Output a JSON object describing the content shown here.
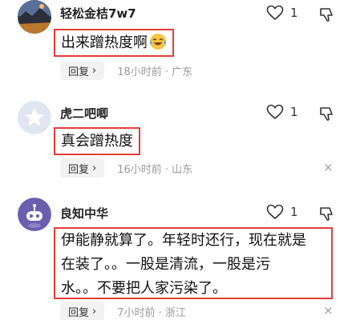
{
  "comments": [
    {
      "username": "轻松金桔7w7",
      "text": "出来蹭热度啊",
      "emoji": "crying-laughing-face-icon",
      "likes": "1",
      "reply_label": "回复",
      "reply_arrow": "›",
      "time_location": "18小时前 · 广东",
      "avatar": "landscape-photo-avatar"
    },
    {
      "username": "虎二吧唧",
      "text": "真会蹭热度",
      "likes": "1",
      "reply_label": "回复",
      "reply_arrow": "›",
      "time_location": "16小时前 · 山东",
      "close_symbol": "×",
      "avatar": "default-star-avatar"
    },
    {
      "username": "良知中华",
      "text_lines": [
        "伊能静就算了。年轻时还行，现在就是",
        "在装了。。一股是清流，一股是污",
        "水。。不要把人家污染了。"
      ],
      "likes": "1",
      "reply_label": "回复",
      "reply_arrow": "›",
      "time_location": "7小时前 · 浙江",
      "close_symbol": "×",
      "avatar": "purple-robot-avatar"
    }
  ],
  "colors": {
    "highlight_border": "#e33c3c",
    "meta_text": "#9a9a9a",
    "reply_bg": "#f2f2f2"
  }
}
